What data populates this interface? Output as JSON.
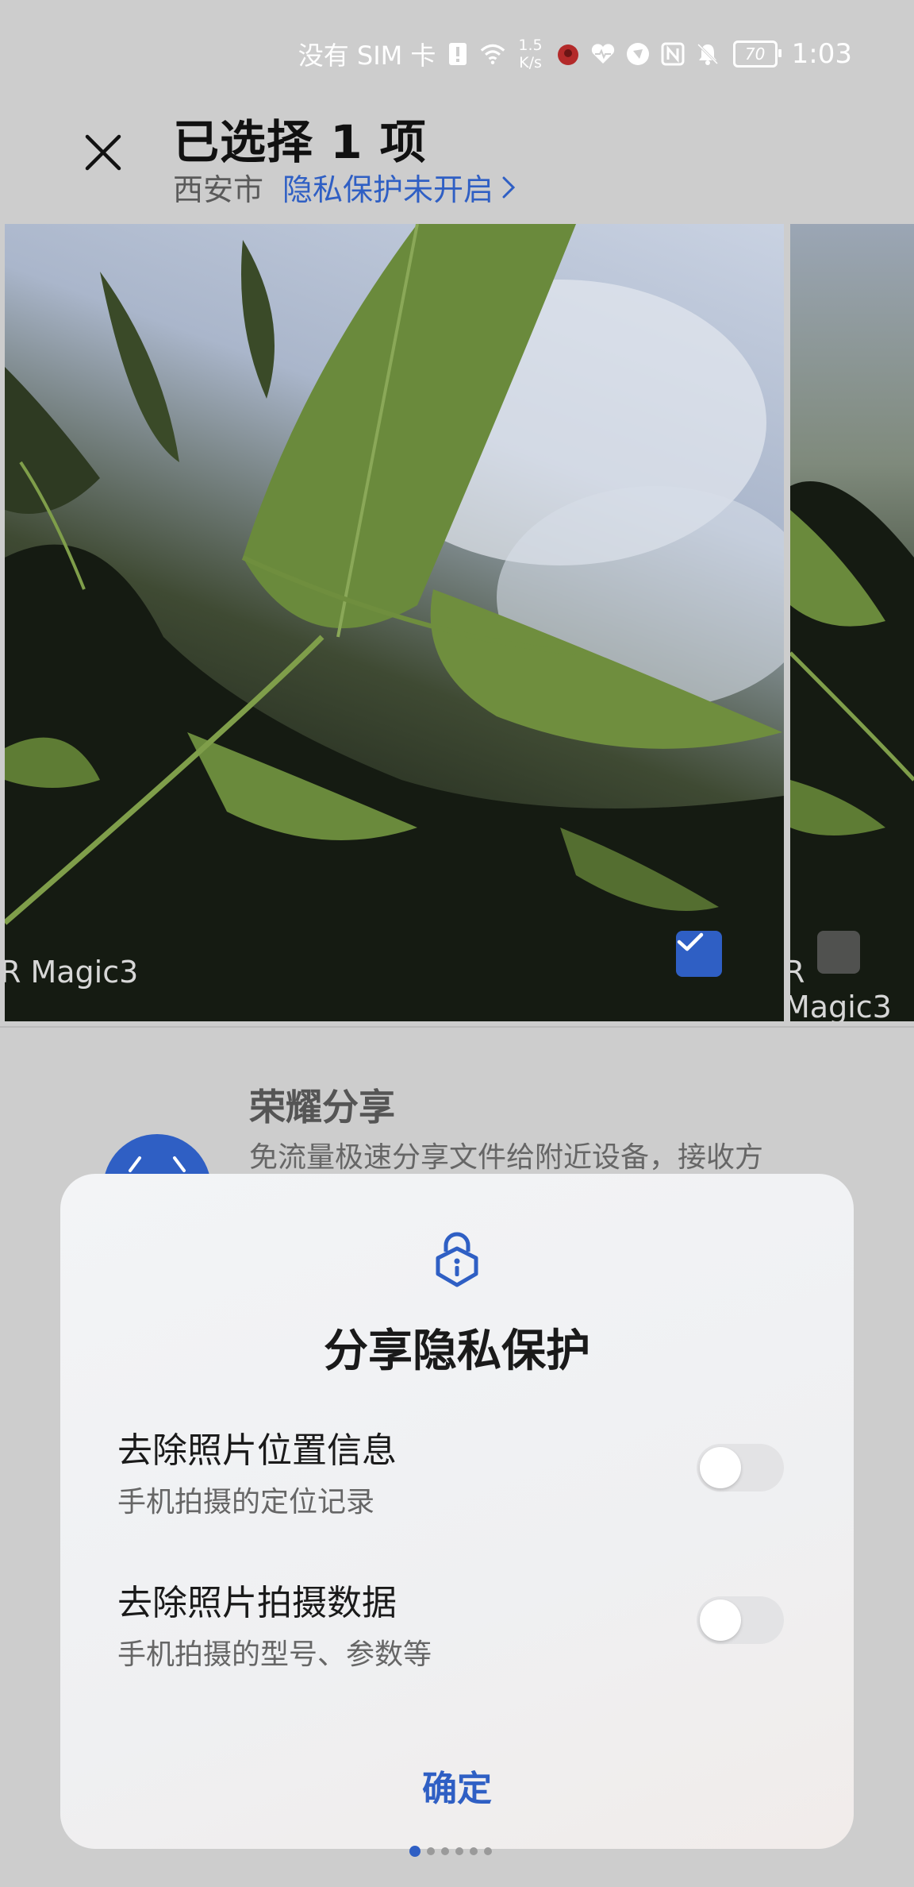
{
  "status_bar": {
    "sim_text": "没有 SIM 卡",
    "net_speed_value": "1.5",
    "net_speed_unit": "K/s",
    "battery": "70",
    "time": "1:03"
  },
  "header": {
    "title": "已选择 1 项",
    "location": "西安市",
    "privacy_link": "隐私保护未开启"
  },
  "photos": {
    "watermark_main": "R Magic3",
    "watermark_next": "R Magic3",
    "selected_count": 1
  },
  "share_option": {
    "title": "荣耀分享",
    "description": "免流量极速分享文件给附近设备，接收方"
  },
  "dialog": {
    "title": "分享隐私保护",
    "options": [
      {
        "title": "去除照片位置信息",
        "subtitle": "手机拍摄的定位记录",
        "enabled": false
      },
      {
        "title": "去除照片拍摄数据",
        "subtitle": "手机拍摄的型号、参数等",
        "enabled": false
      }
    ],
    "confirm_label": "确定"
  },
  "page_indicator": {
    "count": 6,
    "active": 0
  },
  "colors": {
    "accent": "#2f5fc4",
    "toggle_off": "#e3e3e5",
    "dialog_bg": "#f2f3f5",
    "scrim": "#cdcdcd"
  }
}
